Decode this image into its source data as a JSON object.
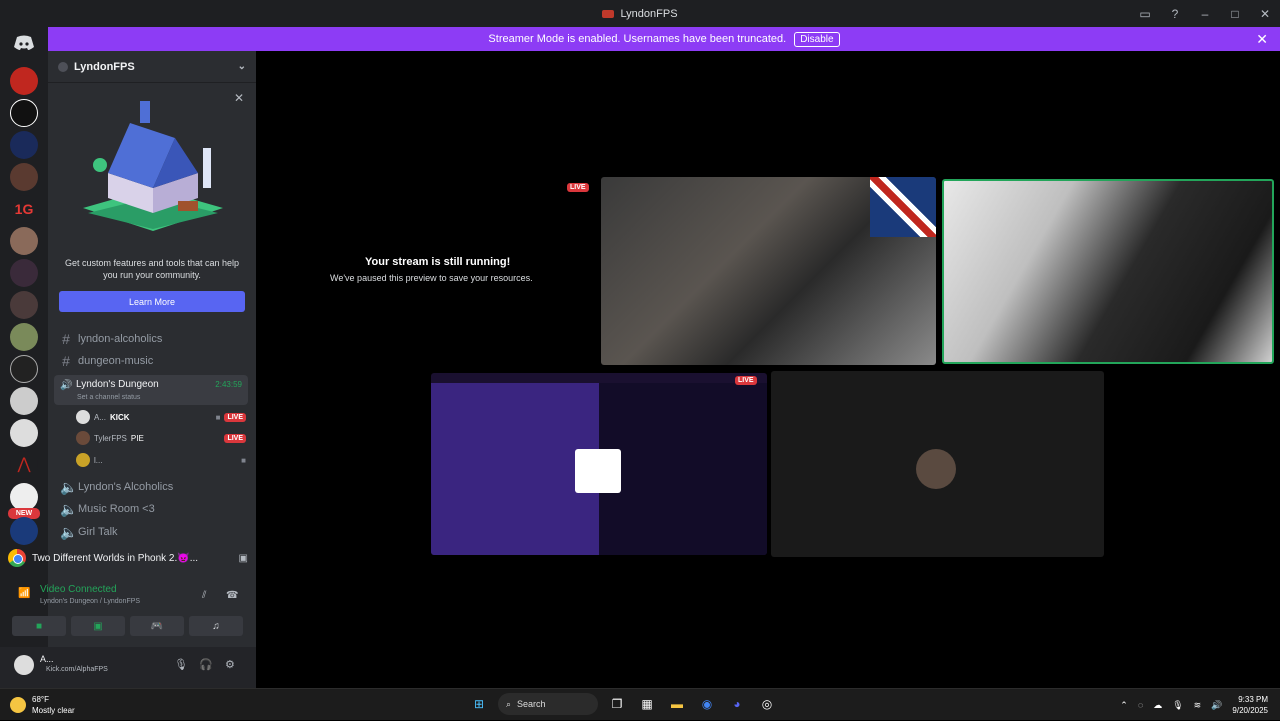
{
  "window": {
    "title": "LyndonFPS"
  },
  "banner": {
    "text": "Streamer Mode is enabled. Usernames have been truncated.",
    "button": "Disable"
  },
  "server": {
    "name": "LyndonFPS"
  },
  "promo": {
    "text": "Get custom features and tools that can help you run your community.",
    "button": "Learn More"
  },
  "channels": {
    "text1": "lyndon-alcoholics",
    "text2": "dungeon-music",
    "voice_active": {
      "name": "Lyndon's Dungeon",
      "time": "2:43:59",
      "status": "Set a channel status"
    },
    "users": [
      {
        "name": "A...",
        "tag": "KICK",
        "live": "LIVE"
      },
      {
        "name": "TylerFPS",
        "tag": "PIE",
        "live": "LIVE"
      },
      {
        "name": "l..."
      }
    ],
    "voice2": "Lyndon's Alcoholics",
    "voice3": "Music Room <3",
    "voice4": "Girl Talk"
  },
  "activity": {
    "title": "Two Different Worlds in Phonk 2.👿..."
  },
  "voice_panel": {
    "status": "Video Connected",
    "sub": "Lyndon's Dungeon / LyndonFPS"
  },
  "userbar": {
    "name": "A...",
    "status": "Kick.com/AlphaFPS"
  },
  "stage": {
    "paused_title": "Your stream is still running!",
    "paused_sub": "We've paused this preview to save your resources.",
    "live1": "LIVE",
    "live2": "LIVE"
  },
  "taskbar": {
    "temp": "68°F",
    "weather": "Mostly clear",
    "search": "Search",
    "time": "9:33 PM",
    "date": "9/20/2025"
  },
  "colors": {
    "blurple": "#5865f2",
    "streamer_banner": "#8d3cf5",
    "live": "#da373c",
    "green": "#23a55a"
  }
}
